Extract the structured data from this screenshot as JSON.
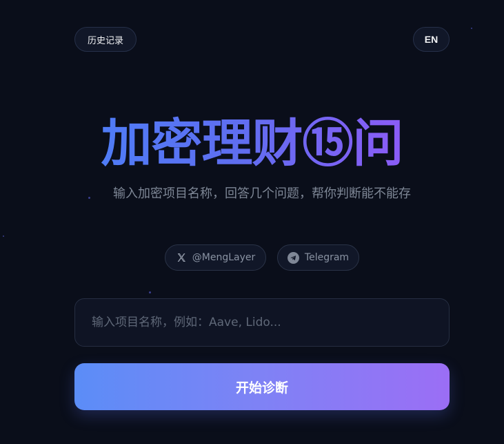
{
  "header": {
    "history_label": "历史记录",
    "lang_label": "EN"
  },
  "hero": {
    "title": "加密理财⑮问",
    "subtitle": "输入加密项目名称，回答几个问题，帮你判断能不能存"
  },
  "social": {
    "x_label": "@MengLayer",
    "x_icon": "x-logo-icon",
    "telegram_label": "Telegram",
    "telegram_icon": "telegram-icon"
  },
  "search": {
    "placeholder": "输入项目名称，例如：Aave, Lido...",
    "value": ""
  },
  "actions": {
    "start_label": "开始诊断"
  },
  "colors": {
    "background": "#0a0e1a",
    "gradient_start": "#5b8df7",
    "gradient_end": "#9b6ef5",
    "title_gradient_start": "#4f7cf7",
    "title_gradient_end": "#8b5cf6"
  }
}
